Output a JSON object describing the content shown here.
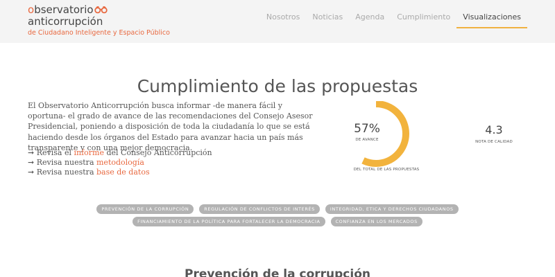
{
  "header": {
    "logo": {
      "word1_first": "o",
      "word1_rest": "bservatorio",
      "word2": "anticorrupción",
      "tagline": "de Ciudadano Inteligente y Espacio Público",
      "accent_color": "#e8683f"
    },
    "nav": [
      {
        "label": "Nosotros",
        "active": false
      },
      {
        "label": "Noticias",
        "active": false
      },
      {
        "label": "Agenda",
        "active": false
      },
      {
        "label": "Cumplimiento",
        "active": false
      },
      {
        "label": "Visualizaciones",
        "active": true
      }
    ],
    "nav_active_color": "#f0b13f"
  },
  "main": {
    "title": "Cumplimiento de las propuestas",
    "description": "El Observatorio Anticorrupción busca informar -de manera fácil y oportuna- el grado de avance de las recomendaciones del Consejo Asesor Presidencial, poniendo a disposición de toda la ciudadanía lo que se está haciendo desde los órganos del Estado para avanzar hacia un país más transparente y con una mejor democracia.",
    "links": [
      {
        "prefix": "➞ Revisa el ",
        "link": "informe",
        "suffix": " del Consejo Anticorrupción"
      },
      {
        "prefix": "➞ Revisa nuestra ",
        "link": "metodología",
        "suffix": ""
      },
      {
        "prefix": "➞ Revisa nuestra ",
        "link": "base de datos",
        "suffix": ""
      }
    ],
    "progress": {
      "value_text": "57%",
      "fraction": 0.57,
      "label": "DE AVANCE",
      "sublabel": "DEL TOTAL DE LAS PROPUESTAS",
      "color": "#f2b33d",
      "track_color": "#ffffff"
    },
    "score": {
      "value": "4.3",
      "label": "NOTA DE CALIDAD"
    },
    "tags_row1": [
      "PREVENCIÓN DE LA CORRUPCIÓN",
      "REGULACIÓN DE CONFLICTOS DE INTERÉS",
      "INTEGRIDAD, ETICA Y DERECHOS CIUDADANOS"
    ],
    "tags_row2": [
      "FINANCIAMIENTO DE LA POLÍTICA PARA FORTALECER LA DEMOCRACIA",
      "CONFIANZA EN LOS MERCADOS"
    ],
    "tag_color": "#b3b3b3",
    "section_title": "Prevención de la corrupción"
  }
}
